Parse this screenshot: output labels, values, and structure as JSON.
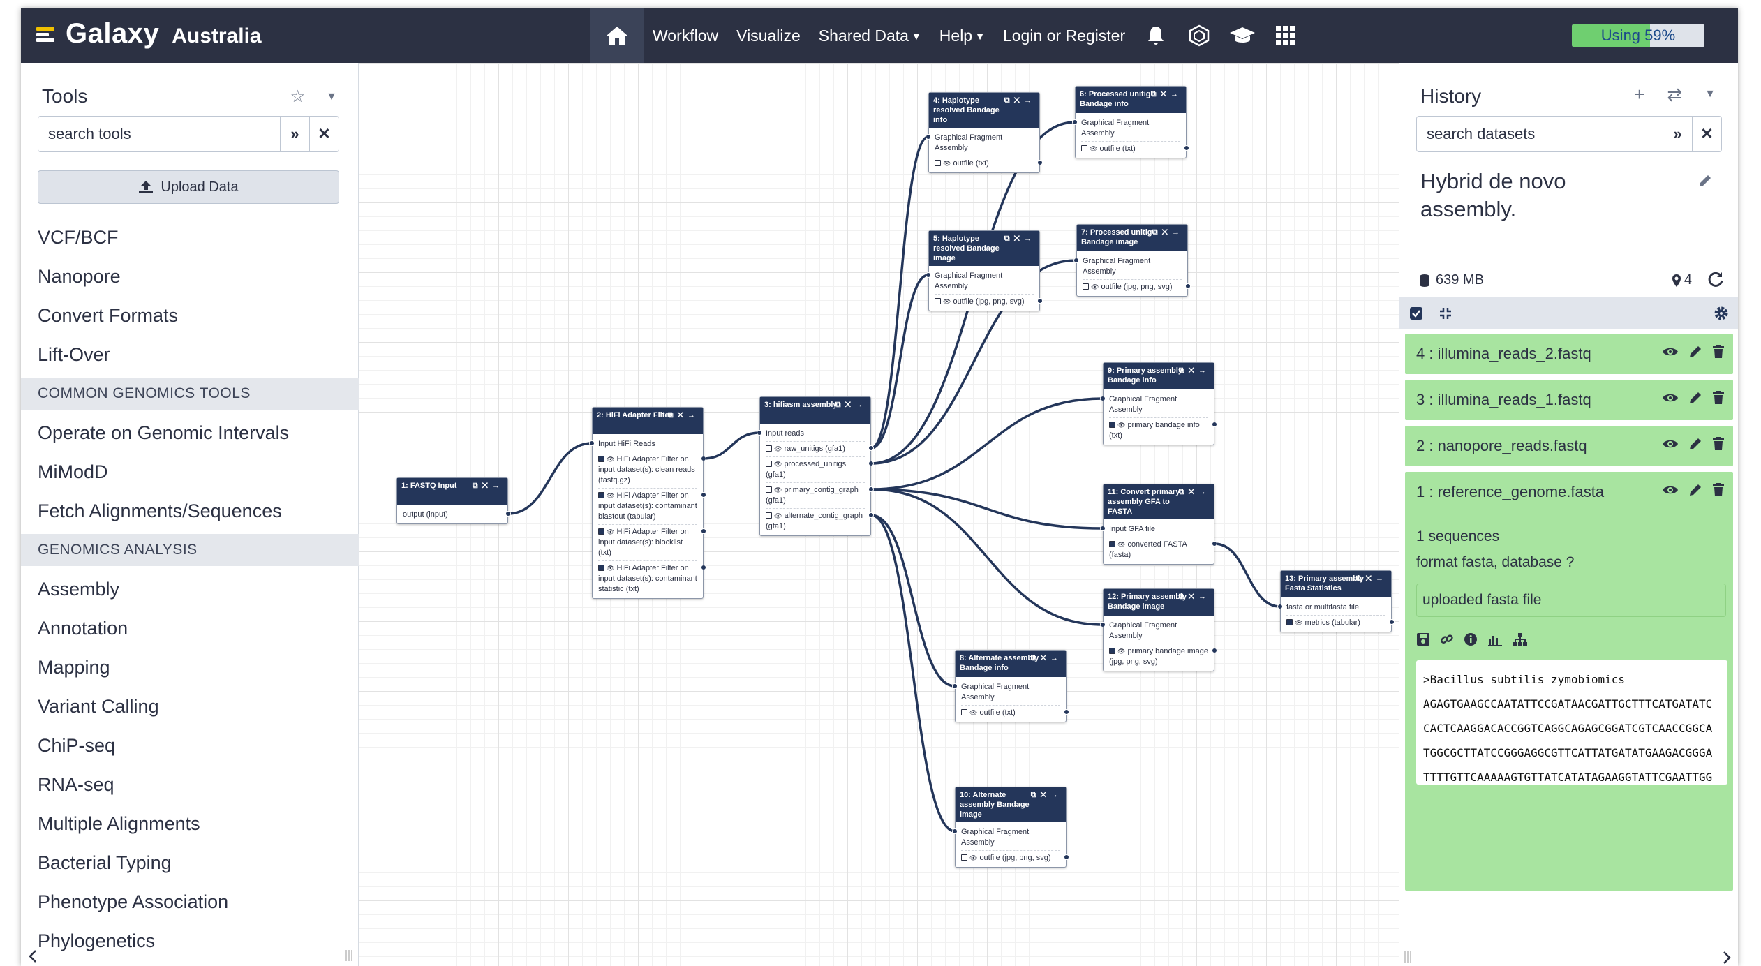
{
  "brand": {
    "name": "Galaxy",
    "subtitle": "Australia"
  },
  "nav": {
    "workflow": "Workflow",
    "visualize": "Visualize",
    "shared_data": "Shared Data",
    "help": "Help",
    "login": "Login or Register"
  },
  "quota": {
    "label": "Using 59%",
    "fraction": 0.59
  },
  "tools": {
    "title": "Tools",
    "search_placeholder": "search tools",
    "upload": "Upload Data",
    "items": [
      {
        "label": "VCF/BCF",
        "type": "tool"
      },
      {
        "label": "Nanopore",
        "type": "tool"
      },
      {
        "label": "Convert Formats",
        "type": "tool"
      },
      {
        "label": "Lift-Over",
        "type": "tool"
      },
      {
        "label": "COMMON GENOMICS TOOLS",
        "type": "section"
      },
      {
        "label": "Operate on Genomic Intervals",
        "type": "tool"
      },
      {
        "label": "MiModD",
        "type": "tool"
      },
      {
        "label": "Fetch Alignments/Sequences",
        "type": "tool"
      },
      {
        "label": "GENOMICS ANALYSIS",
        "type": "section"
      },
      {
        "label": "Assembly",
        "type": "tool"
      },
      {
        "label": "Annotation",
        "type": "tool"
      },
      {
        "label": "Mapping",
        "type": "tool"
      },
      {
        "label": "Variant Calling",
        "type": "tool"
      },
      {
        "label": "ChiP-seq",
        "type": "tool"
      },
      {
        "label": "RNA-seq",
        "type": "tool"
      },
      {
        "label": "Multiple Alignments",
        "type": "tool"
      },
      {
        "label": "Bacterial Typing",
        "type": "tool"
      },
      {
        "label": "Phenotype Association",
        "type": "tool"
      },
      {
        "label": "Phylogenetics",
        "type": "tool"
      }
    ]
  },
  "workflow_nodes": [
    {
      "id": "n1",
      "title": "1: FASTQ Input",
      "rows": [
        {
          "text": "output (input)",
          "out": true
        }
      ]
    },
    {
      "id": "n2",
      "title": "2: HiFi Adapter Filter",
      "rows": [
        {
          "text": "Input HiFi Reads",
          "in": true
        },
        {
          "text": "HiFi Adapter Filter on input dataset(s): clean reads (fastq.gz)",
          "out": true,
          "check": true
        },
        {
          "text": "HiFi Adapter Filter on input dataset(s): contaminant blastout (tabular)",
          "out": true,
          "check": true
        },
        {
          "text": "HiFi Adapter Filter on input dataset(s): blocklist (txt)",
          "out": true,
          "check": true
        },
        {
          "text": "HiFi Adapter Filter on input dataset(s): contaminant statistic (txt)",
          "out": true,
          "check": true
        }
      ]
    },
    {
      "id": "n3",
      "title": "3: hifiasm assembly",
      "rows": [
        {
          "text": "Input reads",
          "in": true
        },
        {
          "text": "raw_unitigs (gfa1)",
          "out": true,
          "check": false
        },
        {
          "text": "processed_unitigs (gfa1)",
          "out": true,
          "check": false
        },
        {
          "text": "primary_contig_graph (gfa1)",
          "out": true,
          "check": false
        },
        {
          "text": "alternate_contig_graph (gfa1)",
          "out": true,
          "check": false
        }
      ]
    },
    {
      "id": "n4",
      "title": "4: Haplotype resolved Bandage info",
      "rows": [
        {
          "text": "Graphical Fragment Assembly",
          "in": true
        },
        {
          "text": "outfile (txt)",
          "out": true,
          "check": false
        }
      ]
    },
    {
      "id": "n5",
      "title": "5: Haplotype resolved Bandage image",
      "rows": [
        {
          "text": "Graphical Fragment Assembly",
          "in": true
        },
        {
          "text": "outfile (jpg, png, svg)",
          "out": true,
          "check": false
        }
      ]
    },
    {
      "id": "n6",
      "title": "6: Processed unitig Bandage info",
      "rows": [
        {
          "text": "Graphical Fragment Assembly",
          "in": true
        },
        {
          "text": "outfile (txt)",
          "out": true,
          "check": false
        }
      ]
    },
    {
      "id": "n7",
      "title": "7: Processed unitig Bandage image",
      "rows": [
        {
          "text": "Graphical Fragment Assembly",
          "in": true
        },
        {
          "text": "outfile (jpg, png, svg)",
          "out": true,
          "check": false
        }
      ]
    },
    {
      "id": "n8",
      "title": "8: Alternate assembly Bandage info",
      "rows": [
        {
          "text": "Graphical Fragment Assembly",
          "in": true
        },
        {
          "text": "outfile (txt)",
          "out": true,
          "check": false
        }
      ]
    },
    {
      "id": "n9",
      "title": "9: Primary assembly Bandage info",
      "rows": [
        {
          "text": "Graphical Fragment Assembly",
          "in": true
        },
        {
          "text": "primary bandage info (txt)",
          "out": true,
          "check": true
        }
      ]
    },
    {
      "id": "n10",
      "title": "10: Alternate assembly Bandage image",
      "rows": [
        {
          "text": "Graphical Fragment Assembly",
          "in": true
        },
        {
          "text": "outfile (jpg, png, svg)",
          "out": true,
          "check": false
        }
      ]
    },
    {
      "id": "n11",
      "title": "11: Convert primary assembly GFA to FASTA",
      "rows": [
        {
          "text": "Input GFA file",
          "in": true
        },
        {
          "text": "converted FASTA (fasta)",
          "out": true,
          "check": true
        }
      ]
    },
    {
      "id": "n12",
      "title": "12: Primary assembly Bandage image",
      "rows": [
        {
          "text": "Graphical Fragment Assembly",
          "in": true
        },
        {
          "text": "primary bandage image (jpg, png, svg)",
          "out": true,
          "check": true
        }
      ]
    },
    {
      "id": "n13",
      "title": "13: Primary assembly Fasta Statistics",
      "rows": [
        {
          "text": "fasta or multifasta file",
          "in": true
        },
        {
          "text": "metrics (tabular)",
          "out": true,
          "check": true
        }
      ]
    }
  ],
  "history": {
    "title": "History",
    "search_placeholder": "search datasets",
    "name": "Hybrid de novo assembly.",
    "size": "639 MB",
    "count": "4",
    "datasets": [
      {
        "label": "4 : illumina_reads_2.fastq"
      },
      {
        "label": "3 : illumina_reads_1.fastq"
      },
      {
        "label": "2 : nanopore_reads.fastq"
      },
      {
        "label": "1 : reference_genome.fasta",
        "sequences": "1 sequences",
        "format": "format fasta,  database ?",
        "info": "uploaded fasta file",
        "peek": [
          ">Bacillus subtilis zymobiomics",
          "AGAGTGAAGCCAATATTCCGATAACGATTGCTTTCATGATATC",
          "CACTCAAGGACACCGGTCAGGCAGAGCGGATCGTCAACCGGCA",
          "TGGCGCTTATCCGGGAGGCGTTCATTATGATATGAAGACGGGA",
          "TTTTGTTCAAAAAGTGTTATCATATAGAAGGTATTCGAATTGG"
        ]
      }
    ]
  }
}
